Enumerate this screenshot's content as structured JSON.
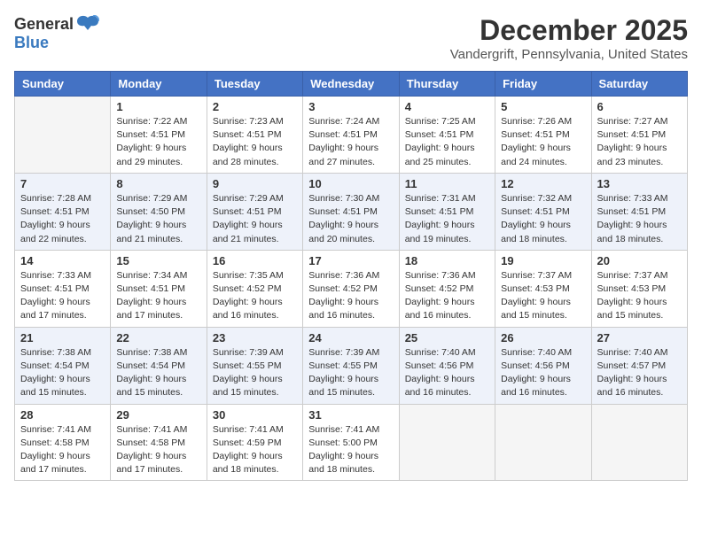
{
  "header": {
    "logo": {
      "general": "General",
      "blue": "Blue"
    },
    "title": "December 2025",
    "location": "Vandergrift, Pennsylvania, United States"
  },
  "days_of_week": [
    "Sunday",
    "Monday",
    "Tuesday",
    "Wednesday",
    "Thursday",
    "Friday",
    "Saturday"
  ],
  "weeks": [
    [
      {
        "day": "",
        "empty": true
      },
      {
        "day": "1",
        "sunrise": "7:22 AM",
        "sunset": "4:51 PM",
        "daylight": "9 hours and 29 minutes."
      },
      {
        "day": "2",
        "sunrise": "7:23 AM",
        "sunset": "4:51 PM",
        "daylight": "9 hours and 28 minutes."
      },
      {
        "day": "3",
        "sunrise": "7:24 AM",
        "sunset": "4:51 PM",
        "daylight": "9 hours and 27 minutes."
      },
      {
        "day": "4",
        "sunrise": "7:25 AM",
        "sunset": "4:51 PM",
        "daylight": "9 hours and 25 minutes."
      },
      {
        "day": "5",
        "sunrise": "7:26 AM",
        "sunset": "4:51 PM",
        "daylight": "9 hours and 24 minutes."
      },
      {
        "day": "6",
        "sunrise": "7:27 AM",
        "sunset": "4:51 PM",
        "daylight": "9 hours and 23 minutes."
      }
    ],
    [
      {
        "day": "7",
        "sunrise": "7:28 AM",
        "sunset": "4:51 PM",
        "daylight": "9 hours and 22 minutes."
      },
      {
        "day": "8",
        "sunrise": "7:29 AM",
        "sunset": "4:50 PM",
        "daylight": "9 hours and 21 minutes."
      },
      {
        "day": "9",
        "sunrise": "7:29 AM",
        "sunset": "4:51 PM",
        "daylight": "9 hours and 21 minutes."
      },
      {
        "day": "10",
        "sunrise": "7:30 AM",
        "sunset": "4:51 PM",
        "daylight": "9 hours and 20 minutes."
      },
      {
        "day": "11",
        "sunrise": "7:31 AM",
        "sunset": "4:51 PM",
        "daylight": "9 hours and 19 minutes."
      },
      {
        "day": "12",
        "sunrise": "7:32 AM",
        "sunset": "4:51 PM",
        "daylight": "9 hours and 18 minutes."
      },
      {
        "day": "13",
        "sunrise": "7:33 AM",
        "sunset": "4:51 PM",
        "daylight": "9 hours and 18 minutes."
      }
    ],
    [
      {
        "day": "14",
        "sunrise": "7:33 AM",
        "sunset": "4:51 PM",
        "daylight": "9 hours and 17 minutes."
      },
      {
        "day": "15",
        "sunrise": "7:34 AM",
        "sunset": "4:51 PM",
        "daylight": "9 hours and 17 minutes."
      },
      {
        "day": "16",
        "sunrise": "7:35 AM",
        "sunset": "4:52 PM",
        "daylight": "9 hours and 16 minutes."
      },
      {
        "day": "17",
        "sunrise": "7:36 AM",
        "sunset": "4:52 PM",
        "daylight": "9 hours and 16 minutes."
      },
      {
        "day": "18",
        "sunrise": "7:36 AM",
        "sunset": "4:52 PM",
        "daylight": "9 hours and 16 minutes."
      },
      {
        "day": "19",
        "sunrise": "7:37 AM",
        "sunset": "4:53 PM",
        "daylight": "9 hours and 15 minutes."
      },
      {
        "day": "20",
        "sunrise": "7:37 AM",
        "sunset": "4:53 PM",
        "daylight": "9 hours and 15 minutes."
      }
    ],
    [
      {
        "day": "21",
        "sunrise": "7:38 AM",
        "sunset": "4:54 PM",
        "daylight": "9 hours and 15 minutes."
      },
      {
        "day": "22",
        "sunrise": "7:38 AM",
        "sunset": "4:54 PM",
        "daylight": "9 hours and 15 minutes."
      },
      {
        "day": "23",
        "sunrise": "7:39 AM",
        "sunset": "4:55 PM",
        "daylight": "9 hours and 15 minutes."
      },
      {
        "day": "24",
        "sunrise": "7:39 AM",
        "sunset": "4:55 PM",
        "daylight": "9 hours and 15 minutes."
      },
      {
        "day": "25",
        "sunrise": "7:40 AM",
        "sunset": "4:56 PM",
        "daylight": "9 hours and 16 minutes."
      },
      {
        "day": "26",
        "sunrise": "7:40 AM",
        "sunset": "4:56 PM",
        "daylight": "9 hours and 16 minutes."
      },
      {
        "day": "27",
        "sunrise": "7:40 AM",
        "sunset": "4:57 PM",
        "daylight": "9 hours and 16 minutes."
      }
    ],
    [
      {
        "day": "28",
        "sunrise": "7:41 AM",
        "sunset": "4:58 PM",
        "daylight": "9 hours and 17 minutes."
      },
      {
        "day": "29",
        "sunrise": "7:41 AM",
        "sunset": "4:58 PM",
        "daylight": "9 hours and 17 minutes."
      },
      {
        "day": "30",
        "sunrise": "7:41 AM",
        "sunset": "4:59 PM",
        "daylight": "9 hours and 18 minutes."
      },
      {
        "day": "31",
        "sunrise": "7:41 AM",
        "sunset": "5:00 PM",
        "daylight": "9 hours and 18 minutes."
      },
      {
        "day": "",
        "empty": true
      },
      {
        "day": "",
        "empty": true
      },
      {
        "day": "",
        "empty": true
      }
    ]
  ]
}
